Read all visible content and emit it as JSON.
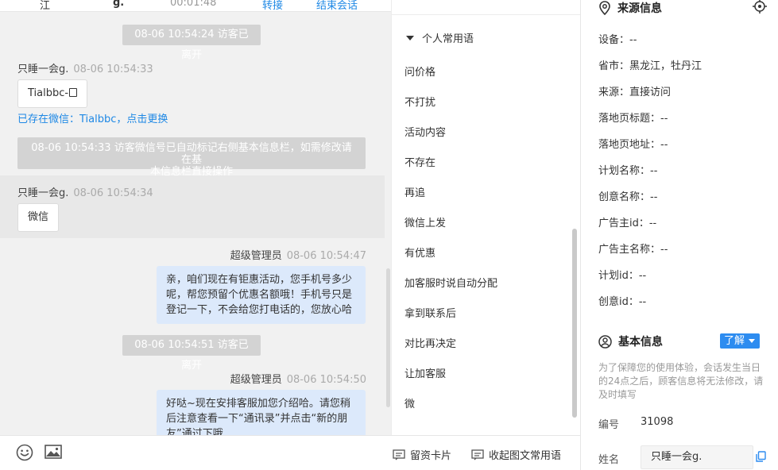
{
  "topbar": {
    "col1": "江",
    "col2": "g.",
    "duration": "00:01:48",
    "transfer": "转接",
    "end": "结束会话"
  },
  "chat": {
    "sys1": "08-06 10:54:24 访客已离开",
    "msg1": {
      "sender": "只睡一会g.",
      "time": "08-06 10:54:33",
      "text": "Tialbbc-"
    },
    "exists_link": "已存在微信：Tialbbc，点击更换",
    "sys2_line1": "08-06 10:54:33 访客微信号已自动标记右侧基本信息栏，如需修改请在基",
    "sys2_line2": "本信息栏直接操作",
    "msg2": {
      "sender": "只睡一会g.",
      "time": "08-06 10:54:34",
      "text": "微信"
    },
    "msg3": {
      "sender": "超级管理员",
      "time": "08-06 10:54:47",
      "line1": "亲，咱们现在有钜惠活动，您手机号多少",
      "line2": "呢，帮您预留个优惠名额哦！手机号只是",
      "line3": "登记一下，不会给您打电话的，您放心哈"
    },
    "sys3": "08-06 10:54:51 访客已离开",
    "msg4": {
      "sender": "超级管理员",
      "time": "08-06 10:54:50",
      "line1": "好哒~现在安排客服加您介绍哈。请您稍",
      "line2": "后注意查看一下“通讯录”并点击“新的朋",
      "line3": "友”通过下哦"
    }
  },
  "composer": {
    "emoji_icon": "smiley-icon",
    "image_icon": "image-icon",
    "card_label": "留资卡片",
    "collect_label": "收起图文常用语"
  },
  "phrases": {
    "header": "个人常用语",
    "items": [
      "问价格",
      "不打扰",
      "活动内容",
      "不存在",
      "再追",
      "微信上发",
      "有优惠",
      "加客服时说自动分配",
      "拿到联系后",
      "对比再决定",
      "让加客服",
      "微"
    ]
  },
  "info": {
    "source_title": "来源信息",
    "source_rows": [
      "设备：--",
      "省市：黑龙江，牡丹江",
      "来源：直接访问",
      "落地页标题：--",
      "落地页地址：--",
      "计划名称：--",
      "创意名称：--",
      "广告主id：--",
      "广告主名称：--",
      "计划id：--",
      "创意id：--"
    ],
    "basic_title": "基本信息",
    "learn_more": "了解",
    "note_line1": "为了保障您的使用体验，会话发生当日",
    "note_line2": "的24点之后，顾客信息将无法修改，请",
    "note_line3": "及时填写",
    "id_label": "编号",
    "id_value": "31098",
    "name_label": "姓名",
    "name_value": "只睡一会g."
  }
}
